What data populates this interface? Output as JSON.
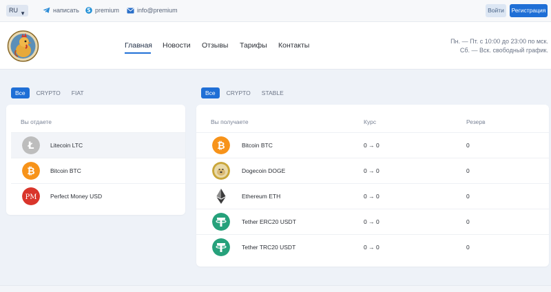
{
  "topbar": {
    "lang": "RU",
    "telegram": "написать",
    "skype": "premium",
    "email": "info@premium",
    "login": "Войти",
    "register": "Регистрация"
  },
  "nav": [
    {
      "label": "Главная"
    },
    {
      "label": "Новости"
    },
    {
      "label": "Отзывы"
    },
    {
      "label": "Тарифы"
    },
    {
      "label": "Контакты"
    }
  ],
  "schedule": {
    "line1": "Пн. — Пт. с 10:00 до 23:00 по мск.",
    "line2": "Сб. — Вск. свободный график."
  },
  "give": {
    "tabs": [
      "Все",
      "CRYPTO",
      "FIAT"
    ],
    "header": "Вы отдаете",
    "rows": [
      {
        "name": "Litecoin LTC",
        "icon": "litecoin-icon",
        "color": "#bdbdbd"
      },
      {
        "name": "Bitcoin BTC",
        "icon": "bitcoin-icon",
        "color": "#f7931a"
      },
      {
        "name": "Perfect Money USD",
        "icon": "perfect-money-icon",
        "color": "#d9352b"
      }
    ]
  },
  "receive": {
    "tabs": [
      "Все",
      "CRYPTO",
      "STABLE"
    ],
    "headers": {
      "get": "Вы получаете",
      "rate": "Курс",
      "reserve": "Резерв"
    },
    "rows": [
      {
        "name": "Bitcoin BTC",
        "icon": "bitcoin-icon",
        "color": "#f7931a",
        "rate": "0 → 0",
        "reserve": "0"
      },
      {
        "name": "Dogecoin DOGE",
        "icon": "dogecoin-icon",
        "color": "#c9a63a",
        "rate": "0 → 0",
        "reserve": "0"
      },
      {
        "name": "Ethereum ETH",
        "icon": "ethereum-icon",
        "color": "#3c3c3d",
        "rate": "0 → 0",
        "reserve": "0"
      },
      {
        "name": "Tether ERC20 USDT",
        "icon": "tether-icon",
        "color": "#26a17b",
        "rate": "0 → 0",
        "reserve": "0"
      },
      {
        "name": "Tether TRC20 USDT",
        "icon": "tether-icon",
        "color": "#26a17b",
        "rate": "0 → 0",
        "reserve": "0"
      }
    ]
  },
  "colors": {
    "accent": "#1f6fd6",
    "background": "#eef2f8"
  }
}
